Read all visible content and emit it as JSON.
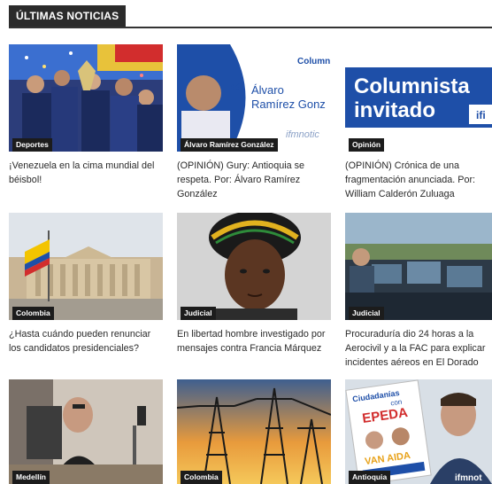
{
  "section": {
    "title": "ÚLTIMAS NOTICIAS"
  },
  "articles": [
    {
      "category": "Deportes",
      "title": "¡Venezuela en la cima mundial del béisbol!"
    },
    {
      "category": "Álvaro Ramírez González",
      "title": "(OPINIÓN) Gury: Antioquia se respeta. Por: Álvaro Ramírez González",
      "image_text": {
        "column": "Column",
        "name_line1": "Álvaro",
        "name_line2": "Ramírez Gonz",
        "logo": "ifmnotic"
      }
    },
    {
      "category": "Opinión",
      "title": "(OPINIÓN) Crónica de una fragmentación anunciada. Por: William Calderón Zuluaga",
      "image_text": {
        "line1": "Columnista",
        "line2": "invitado",
        "logo": "ifi"
      }
    },
    {
      "category": "Colombia",
      "title": "¿Hasta cuándo pueden renunciar los candidatos presidenciales?"
    },
    {
      "category": "Judicial",
      "title": "En libertad hombre investigado por mensajes contra Francia Márquez"
    },
    {
      "category": "Judicial",
      "title": "Procuraduría dio 24 horas a la Aerocivil y a la FAC para explicar incidentes aéreos en El Dorado"
    },
    {
      "category": "Medellín",
      "title": ""
    },
    {
      "category": "Colombia",
      "title": ""
    },
    {
      "category": "Antioquia",
      "title": "",
      "image_text": {
        "poster_top": "Ciudadanías",
        "poster_mid": "con",
        "poster_brand": "EPEDA",
        "names": "VAN AIDA",
        "logo": "ifmnot"
      }
    }
  ],
  "colors": {
    "header_bg": "#2b2b2b",
    "badge_bg": "#1c1c1c",
    "blue_brand": "#1e4fa8",
    "yellow": "#f3c400"
  }
}
